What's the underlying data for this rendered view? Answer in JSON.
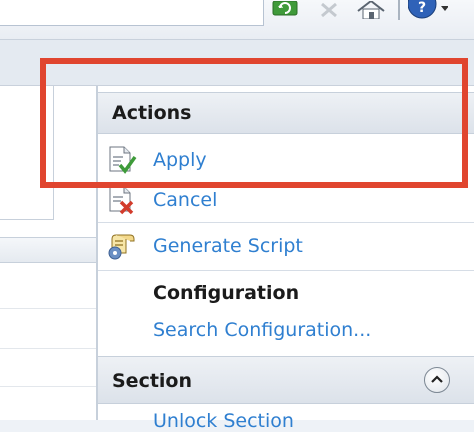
{
  "actions_pane": {
    "header": "Actions",
    "items": [
      {
        "label": "Apply",
        "icon": "apply-icon"
      },
      {
        "label": "Cancel",
        "icon": "cancel-icon"
      },
      {
        "label": "Generate Script",
        "icon": "generate-script-icon"
      }
    ],
    "configuration": {
      "title": "Configuration",
      "link": "Search Configuration..."
    },
    "section": {
      "header": "Section",
      "partial_link": "Unlock Section"
    }
  },
  "colors": {
    "link": "#2f7fd0",
    "highlight": "#e0452f",
    "header_text": "#1b1b1b"
  }
}
